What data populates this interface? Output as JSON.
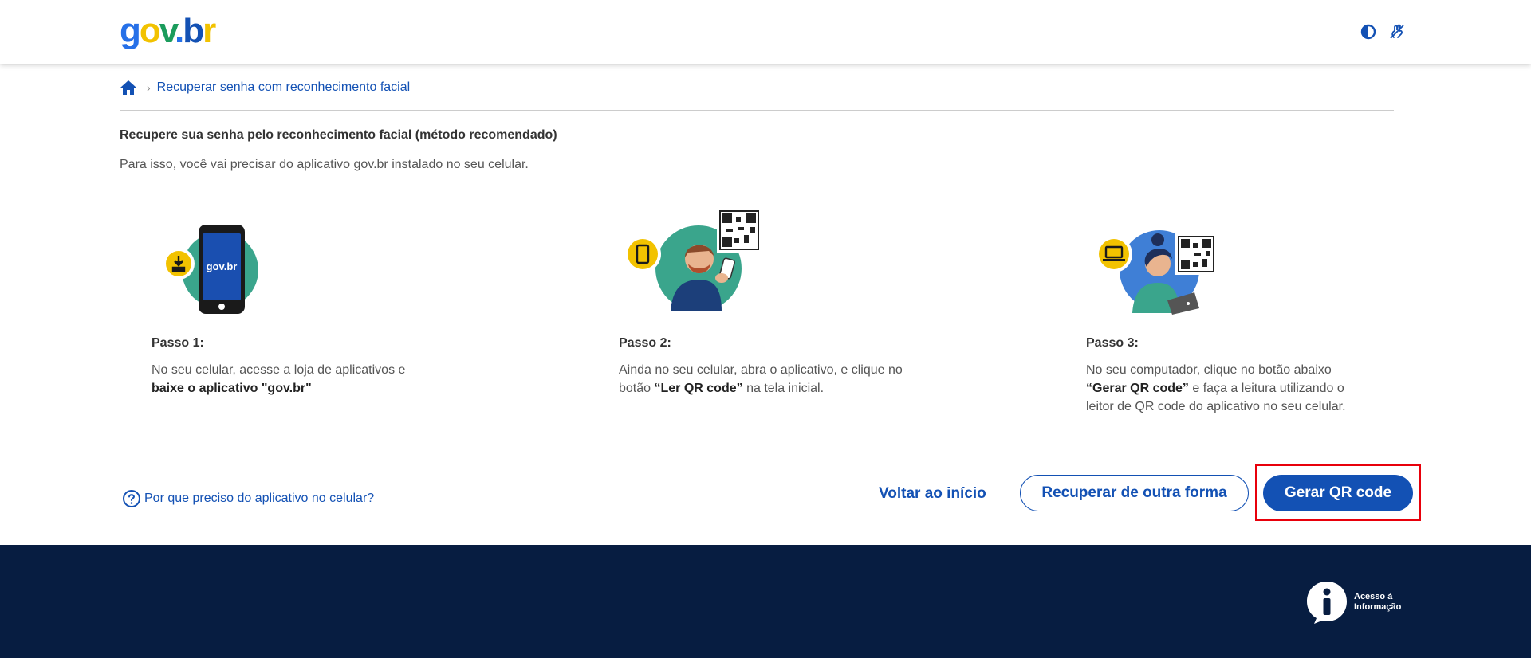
{
  "header": {
    "logo": {
      "g": "g",
      "o": "o",
      "v": "v",
      "dot": ".",
      "b": "b",
      "r": "r"
    },
    "icons": {
      "contrast": "contrast-icon",
      "libras": "libras-icon"
    }
  },
  "breadcrumb": {
    "home_icon": "home-icon",
    "separator": "›",
    "current": "Recuperar senha com reconhecimento facial"
  },
  "main": {
    "title": "Recupere sua senha pelo reconhecimento facial (método recomendado)",
    "subtitle": "Para isso, você vai precisar do aplicativo gov.br instalado no seu celular.",
    "steps": [
      {
        "label": "Passo 1:",
        "illustration_icon": "download-icon",
        "phone_logo": "gov.br",
        "text_1": "No seu celular, acesse a loja de aplicativos e ",
        "text_bold": "baixe o aplicativo \"gov.br\"",
        "text_2": ""
      },
      {
        "label": "Passo 2:",
        "illustration_icon": "phone-icon",
        "text_1": "Ainda no seu celular, abra o aplicativo, e clique no botão ",
        "text_bold": "“Ler QR code”",
        "text_2": " na tela inicial."
      },
      {
        "label": "Passo 3:",
        "illustration_icon": "laptop-icon",
        "text_1": "No seu computador, clique no botão abaixo ",
        "text_bold": "“Gerar QR code”",
        "text_2": " e faça a leitura utilizando o leitor de QR code do aplicativo no seu celular."
      }
    ]
  },
  "actions": {
    "help_link": "Por que preciso do aplicativo no celular?",
    "back_link": "Voltar ao início",
    "secondary_button": "Recuperar de outra forma",
    "primary_button": "Gerar QR code"
  },
  "footer": {
    "lai_text": "Acesso à\nInformação"
  },
  "colors": {
    "primary": "#1351b4",
    "footer_bg": "#071d41",
    "highlight": "#e8000b",
    "teal": "#3aa58c",
    "yellow": "#f2c200"
  }
}
